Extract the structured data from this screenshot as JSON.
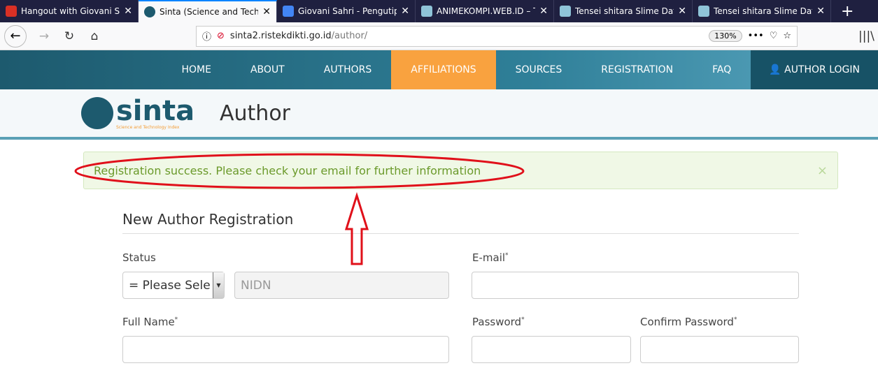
{
  "browser": {
    "tabs": [
      {
        "title": "Hangout with Giovani Sah",
        "icon": "gmail-icon",
        "active": false
      },
      {
        "title": "Sinta (Science and Techno",
        "icon": "sinta-icon",
        "active": true
      },
      {
        "title": "Giovani Sahri - Pengutipan",
        "icon": "google-scholar-icon",
        "active": false
      },
      {
        "title": "ANIMEKOMPI.WEB.ID – Te",
        "icon": "anime-icon",
        "active": false
      },
      {
        "title": "Tensei shitara Slime Datta",
        "icon": "anime-icon",
        "active": false
      },
      {
        "title": "Tensei shitara Slime Datta",
        "icon": "anime-icon",
        "active": false
      }
    ],
    "url_host": "sinta2.ristekdikti.go.id",
    "url_path": "/author/",
    "zoom": "130%"
  },
  "site": {
    "nav": [
      "HOME",
      "ABOUT",
      "AUTHORS",
      "AFFILIATIONS",
      "SOURCES",
      "REGISTRATION",
      "FAQ"
    ],
    "active_nav": "AFFILIATIONS",
    "login": "AUTHOR LOGIN",
    "logo_text": "sinta",
    "logo_sub": "Science and Technology Index",
    "page_title": "Author"
  },
  "alert": {
    "message": "Registration success. Please check your email for further information",
    "close": "×"
  },
  "form": {
    "title": "New Author Registration",
    "status_label": "Status",
    "status_value": "= Please Sele",
    "nidn_placeholder": "NIDN",
    "email_label": "E-mail",
    "fullname_label": "Full Name",
    "password_label": "Password",
    "confirm_label": "Confirm Password",
    "required_mark": "*"
  },
  "colors": {
    "accent": "#f9a23f",
    "teal": "#1d5a6e",
    "alert_text": "#6b9a2b",
    "annotation": "#e0101a"
  }
}
